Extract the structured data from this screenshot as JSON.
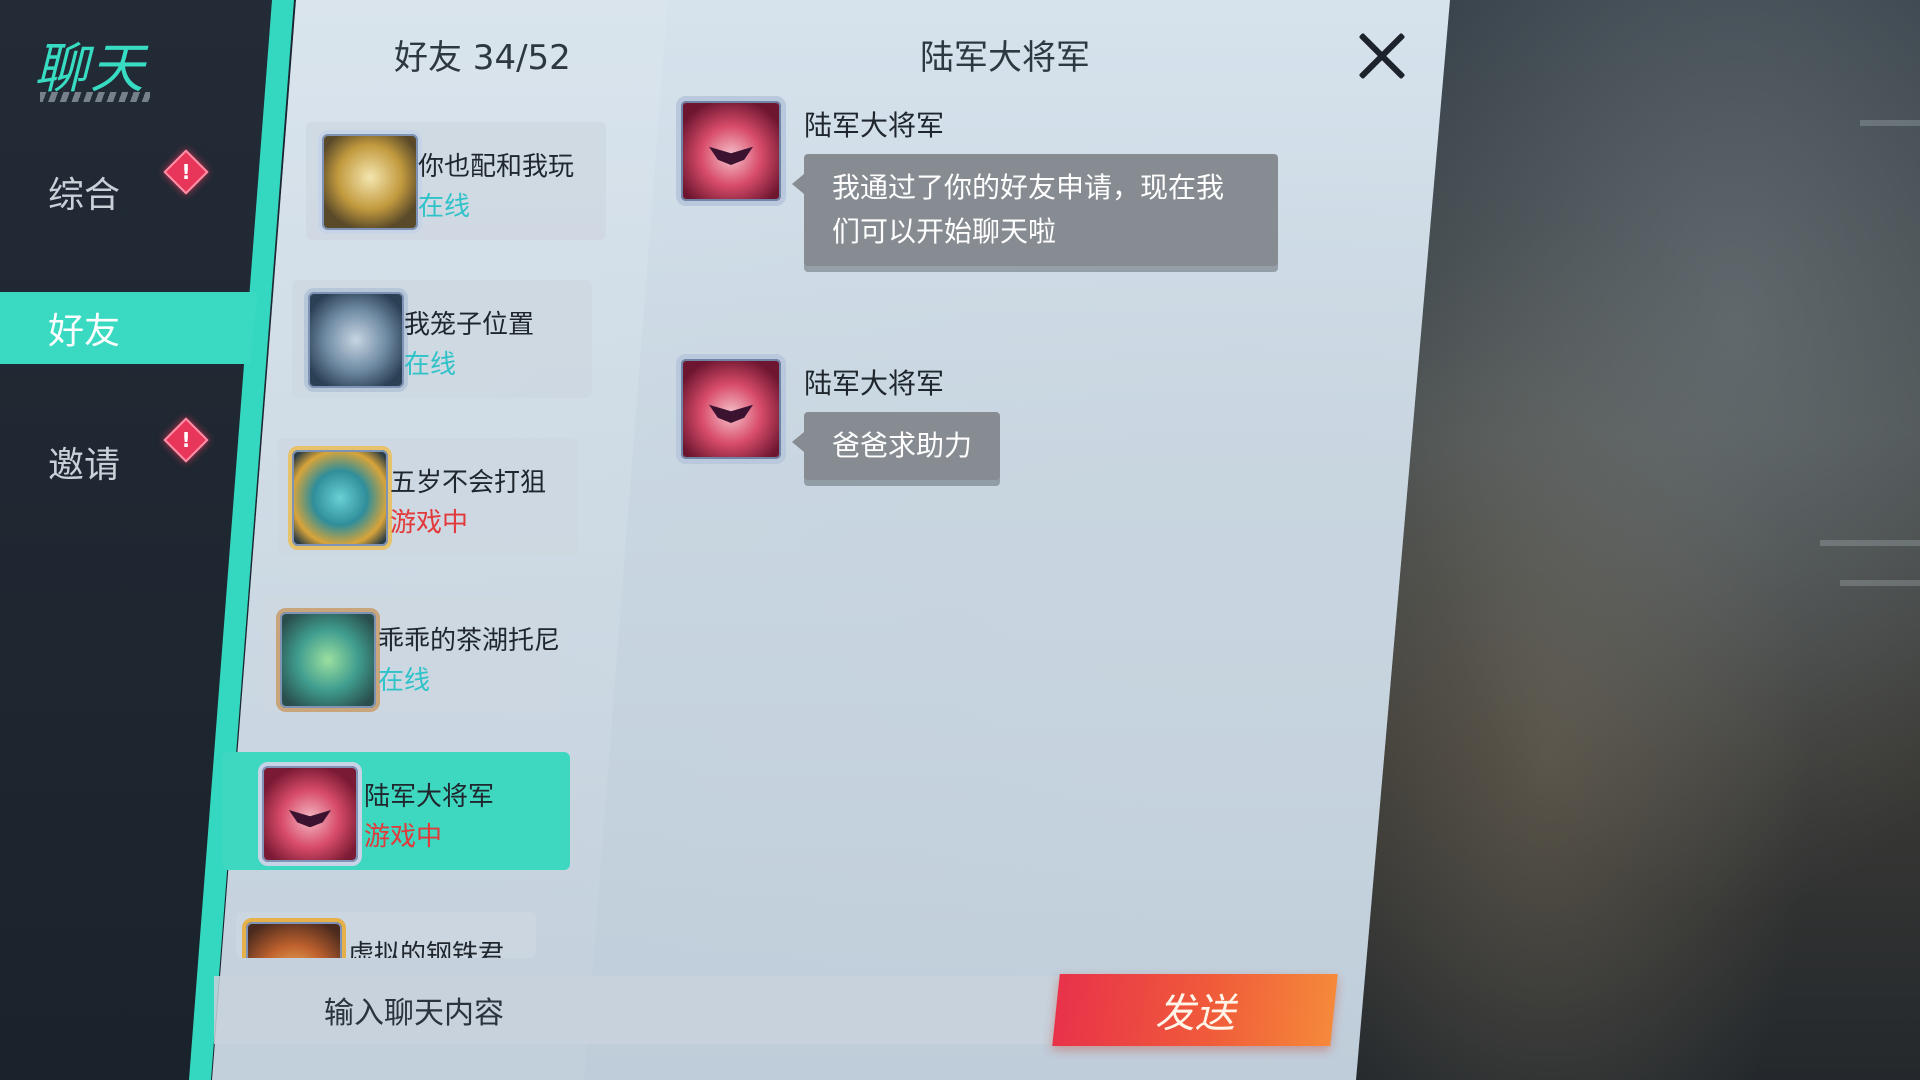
{
  "app": {
    "title": "聊天"
  },
  "nav": {
    "items": [
      {
        "label": "综合",
        "badge": "!"
      },
      {
        "label": "好友"
      },
      {
        "label": "邀请",
        "badge": "!"
      }
    ]
  },
  "friends": {
    "title": "好友 34/52",
    "list": [
      {
        "name": "你也配和我玩",
        "status": "在线"
      },
      {
        "name": "我笼子位置",
        "status": "在线"
      },
      {
        "name": "五岁不会打狙",
        "status": "游戏中"
      },
      {
        "name": "乖乖的茶湖托尼",
        "status": "在线"
      },
      {
        "name": "陆军大将军",
        "status": "游戏中"
      },
      {
        "name": "虚拟的钢铁君"
      }
    ]
  },
  "chat": {
    "title": "陆军大将军",
    "messages": [
      {
        "sender": "陆军大将军",
        "line1": "我通过了你的好友申请，现在我",
        "line2": "们可以开始聊天啦"
      },
      {
        "sender": "陆军大将军",
        "line1": "爸爸求助力"
      }
    ]
  },
  "input": {
    "placeholder": "输入聊天内容"
  },
  "send_label": "发送",
  "colors": {
    "accent": "#3ad9c1",
    "online": "#2fc2c8",
    "ingame": "#e23a3a",
    "send": "#e8324a"
  }
}
